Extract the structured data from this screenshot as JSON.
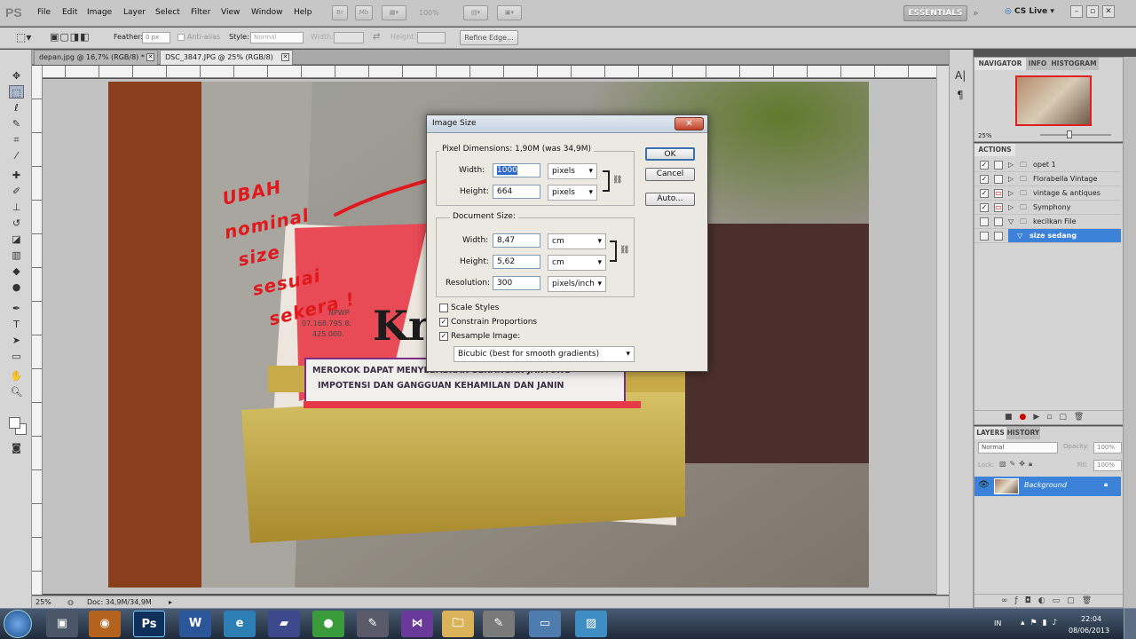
{
  "app": {
    "logo": "PS",
    "menus": [
      "File",
      "Edit",
      "Image",
      "Layer",
      "Select",
      "Filter",
      "View",
      "Window",
      "Help"
    ],
    "zoom_display": "100%",
    "workspace": "ESSENTIALS",
    "cs_live": "CS Live"
  },
  "options": {
    "feather_label": "Feather:",
    "feather_value": "0 px",
    "anti_alias": "Anti-alias",
    "style_label": "Style:",
    "style_value": "Normal",
    "width_label": "Width:",
    "height_label": "Height:",
    "refine_edge": "Refine Edge..."
  },
  "tabs": [
    {
      "label": "depan.jpg @ 16,7% (RGB/8) *"
    },
    {
      "label": "DSC_3847.JPG @ 25% (RGB/8)"
    }
  ],
  "status": {
    "zoom": "25%",
    "doc": "Doc: 34,9M/34,9M"
  },
  "navigator": {
    "tabs": [
      "NAVIGATOR",
      "INFO",
      "HISTOGRAM"
    ],
    "zoom": "25%"
  },
  "actions": {
    "title": "ACTIONS",
    "items": [
      {
        "label": "opet 1",
        "checked": true
      },
      {
        "label": "Florabella Vintage",
        "checked": true
      },
      {
        "label": "vintage & antiques",
        "checked": true
      },
      {
        "label": "Symphony",
        "checked": true
      },
      {
        "label": "kecilkan File",
        "checked": false
      },
      {
        "label": "size sedang",
        "checked": false
      }
    ]
  },
  "layers": {
    "tabs": [
      "LAYERS",
      "HISTORY"
    ],
    "blend": "Normal",
    "opacity_label": "Opacity:",
    "opacity": "100%",
    "lock_label": "Lock:",
    "fill_label": "Fill:",
    "fill": "100%",
    "layer_name": "Background"
  },
  "dialog": {
    "title": "Image Size",
    "pixel_dimensions": "Pixel Dimensions:  1,90M (was 34,9M)",
    "width_label": "Width:",
    "width_value": "1000",
    "width_unit": "pixels",
    "height_label": "Height:",
    "height_value": "664",
    "height_unit": "pixels",
    "document_size": "Document Size:",
    "doc_width_label": "Width:",
    "doc_width": "8,47",
    "doc_width_unit": "cm",
    "doc_height_label": "Height:",
    "doc_height": "5,62",
    "doc_height_unit": "cm",
    "resolution_label": "Resolution:",
    "resolution": "300",
    "resolution_unit": "pixels/inch",
    "scale_styles": "Scale Styles",
    "constrain": "Constrain Proportions",
    "resample": "Resample Image:",
    "method": "Bicubic (best for smooth gradients)",
    "ok": "OK",
    "cancel": "Cancel",
    "auto": "Auto..."
  },
  "annotation": [
    "UBAH",
    "nominal",
    "size",
    "sesuai",
    "sekera !"
  ],
  "photo_text": {
    "brand": "Kr",
    "npwp": "NPWP",
    "npwp_num": "07.168.795.8.",
    "npwp_num2": "425.000.",
    "warn1": "MEROKOK DAPAT MENYEBABKAN SERANGAN JANTUNG",
    "warn2": "IMPOTENSI DAN GANGGUAN KEHAMILAN DAN JANIN"
  },
  "taskbar": {
    "lang": "IN",
    "time": "22:04",
    "date": "08/06/2013"
  }
}
